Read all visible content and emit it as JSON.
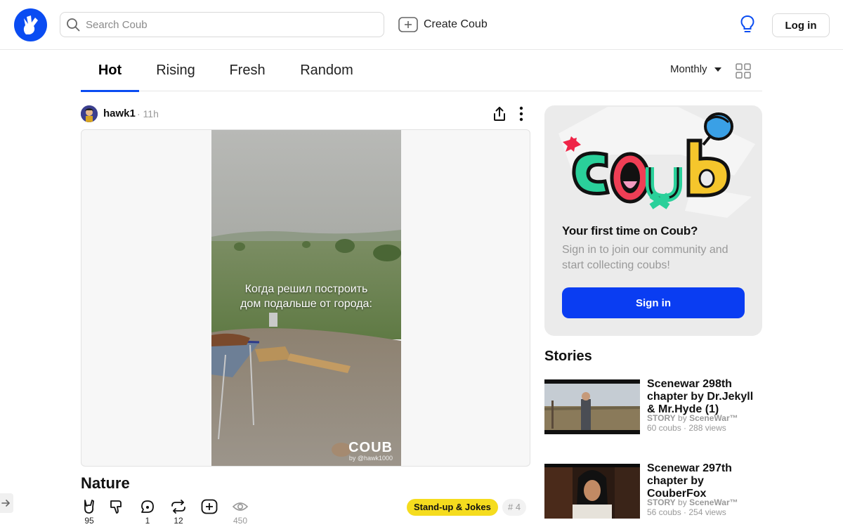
{
  "header": {
    "search_placeholder": "Search Coub",
    "create_label": "Create Coub",
    "login_label": "Log in"
  },
  "tabs": [
    {
      "label": "Hot",
      "active": true
    },
    {
      "label": "Rising",
      "active": false
    },
    {
      "label": "Fresh",
      "active": false
    },
    {
      "label": "Random",
      "active": false
    }
  ],
  "filter": {
    "period": "Monthly"
  },
  "post": {
    "username": "hawk1",
    "time": "· 11h",
    "caption_line1": "Когда решил построить",
    "caption_line2": "дом подальше от города:",
    "watermark": "COUB",
    "watermark_by": "by @hawk1000",
    "title": "Nature",
    "likes": "95",
    "comments": "1",
    "recoubs": "12",
    "views": "450",
    "tag": "Stand-up & Jokes",
    "rank": "# 4"
  },
  "signin_card": {
    "title": "Your first time on Coub?",
    "text": "Sign in to join our community and start collecting coubs!",
    "button": "Sign in"
  },
  "stories": {
    "heading": "Stories",
    "items": [
      {
        "title": "Scenewar 298th chapter by Dr.Jekyll & Mr.Hyde (1)",
        "kind": "STORY",
        "by": "by",
        "author": "SceneWar™",
        "stats": "60 coubs · 288 views"
      },
      {
        "title": "Scenewar 297th chapter by CouberFox",
        "kind": "STORY",
        "by": "by",
        "author": "SceneWar™",
        "stats": "56 coubs · 254 views"
      }
    ]
  },
  "colors": {
    "brand_blue": "#0a4cf2",
    "tag_yellow": "#f5dc1e",
    "signin_blue": "#0a3df2"
  }
}
